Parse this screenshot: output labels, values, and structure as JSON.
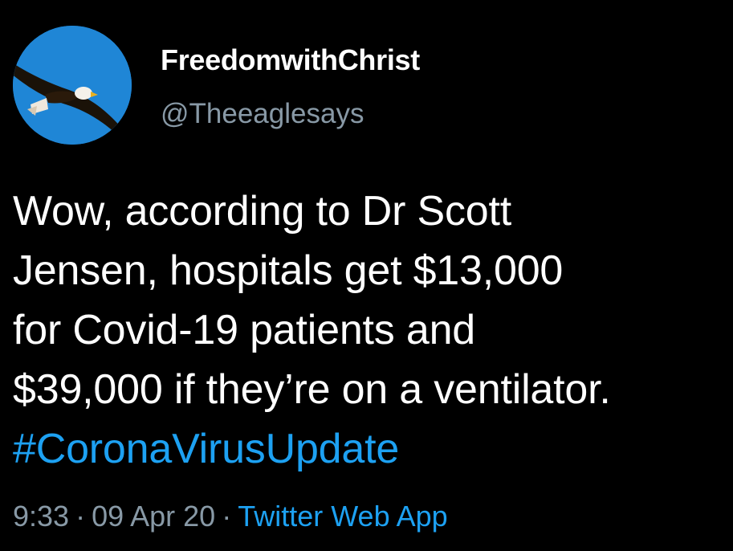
{
  "colors": {
    "background": "#000000",
    "text": "#ffffff",
    "muted": "#8899a6",
    "link": "#1da1f2",
    "avatar_sky": "#1f86d6"
  },
  "author": {
    "display_name": "FreedomwithChrist",
    "handle": "@Theeaglesays",
    "avatar_icon": "eagle-avatar"
  },
  "tweet": {
    "lines": [
      "Wow, according to Dr Scott",
      "Jensen, hospitals get $13,000",
      "for Covid-19 patients and",
      "$39,000 if they’re on a ventilator."
    ],
    "hashtag": "#CoronaVirusUpdate"
  },
  "meta": {
    "time": "9:33",
    "separator": "·",
    "date": "09 Apr 20",
    "source": "Twitter Web App"
  }
}
